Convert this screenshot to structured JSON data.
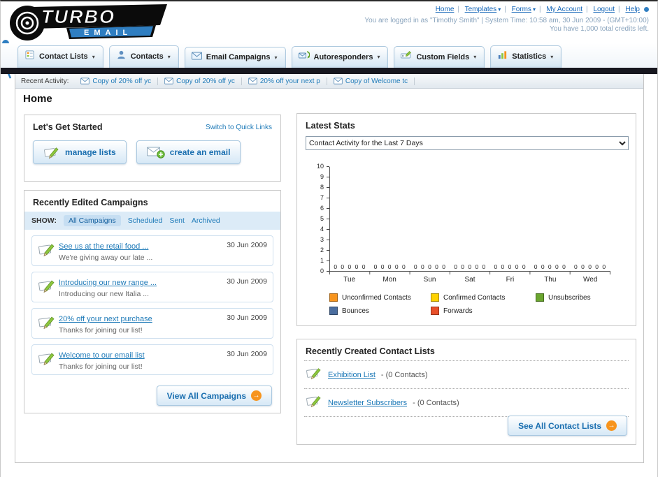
{
  "icons": {
    "caret": "▾",
    "arrow_right": "→"
  },
  "header": {
    "links": [
      "Home",
      "Templates",
      "Forms",
      "My Account",
      "Logout",
      "Help"
    ],
    "login_info": "You are logged in as \"Timothy Smith\" | System Time: 10:58 am, 30 Jun 2009 - (GMT+10:00)",
    "credits": "You have 1,000 total credits left.",
    "logo_line1": "TURBO",
    "logo_line2": "EMAIL"
  },
  "nav": {
    "tabs": [
      {
        "label": "Contact Lists"
      },
      {
        "label": "Contacts"
      },
      {
        "label": "Email Campaigns"
      },
      {
        "label": "Autoresponders"
      },
      {
        "label": "Custom Fields"
      },
      {
        "label": "Statistics"
      }
    ]
  },
  "activity": {
    "label": "Recent Activity:",
    "items": [
      "Copy of 20% off yc",
      "Copy of 20% off yc",
      "20% off your next p",
      "Copy of Welcome tc"
    ]
  },
  "page_title": "Home",
  "get_started": {
    "title": "Let's Get Started",
    "switch_link": "Switch to Quick Links",
    "manage_lists": "manage lists",
    "create_email": "create an email"
  },
  "campaigns": {
    "title": "Recently Edited Campaigns",
    "show_label": "SHOW:",
    "filters": [
      "All Campaigns",
      "Scheduled",
      "Sent",
      "Archived"
    ],
    "items": [
      {
        "title": "See us at the retail food ...",
        "subtitle": "We're giving away our late ...",
        "date": "30 Jun 2009"
      },
      {
        "title": "Introducing our new range ...",
        "subtitle": "Introducing our new Italia ...",
        "date": "30 Jun 2009"
      },
      {
        "title": "20% off your next purchase",
        "subtitle": "Thanks for joining our list!",
        "date": "30 Jun 2009"
      },
      {
        "title": "Welcome to our email list",
        "subtitle": "Thanks for joining our list!",
        "date": "30 Jun 2009"
      }
    ],
    "view_all_label": "View All Campaigns"
  },
  "stats": {
    "title": "Latest Stats",
    "selected_option": "Contact Activity for the Last 7 Days",
    "chart_data": {
      "type": "bar",
      "title": "Contact Activity for the Last 7 Days",
      "categories": [
        "Tue",
        "Mon",
        "Sun",
        "Sat",
        "Fri",
        "Thu",
        "Wed"
      ],
      "series": [
        {
          "name": "Unconfirmed Contacts",
          "color": "#f7941d",
          "values": [
            0,
            0,
            0,
            0,
            0,
            0,
            0
          ]
        },
        {
          "name": "Confirmed Contacts",
          "color": "#ffd200",
          "values": [
            0,
            0,
            0,
            0,
            0,
            0,
            0
          ]
        },
        {
          "name": "Unsubscribes",
          "color": "#6aa52f",
          "values": [
            0,
            0,
            0,
            0,
            0,
            0,
            0
          ]
        },
        {
          "name": "Bounces",
          "color": "#4a6d9e",
          "values": [
            0,
            0,
            0,
            0,
            0,
            0,
            0
          ]
        },
        {
          "name": "Forwards",
          "color": "#e8502a",
          "values": [
            0,
            0,
            0,
            0,
            0,
            0,
            0
          ]
        }
      ],
      "ylim": [
        0,
        10
      ],
      "ytick_step": 1,
      "grid": false,
      "legend_position": "bottom"
    }
  },
  "contact_lists": {
    "title": "Recently Created Contact Lists",
    "items": [
      {
        "name": "Exhibition List",
        "detail": "- (0 Contacts)"
      },
      {
        "name": "Newsletter Subscribers",
        "detail": "- (0 Contacts)"
      }
    ],
    "see_all_label": "See All Contact Lists"
  }
}
